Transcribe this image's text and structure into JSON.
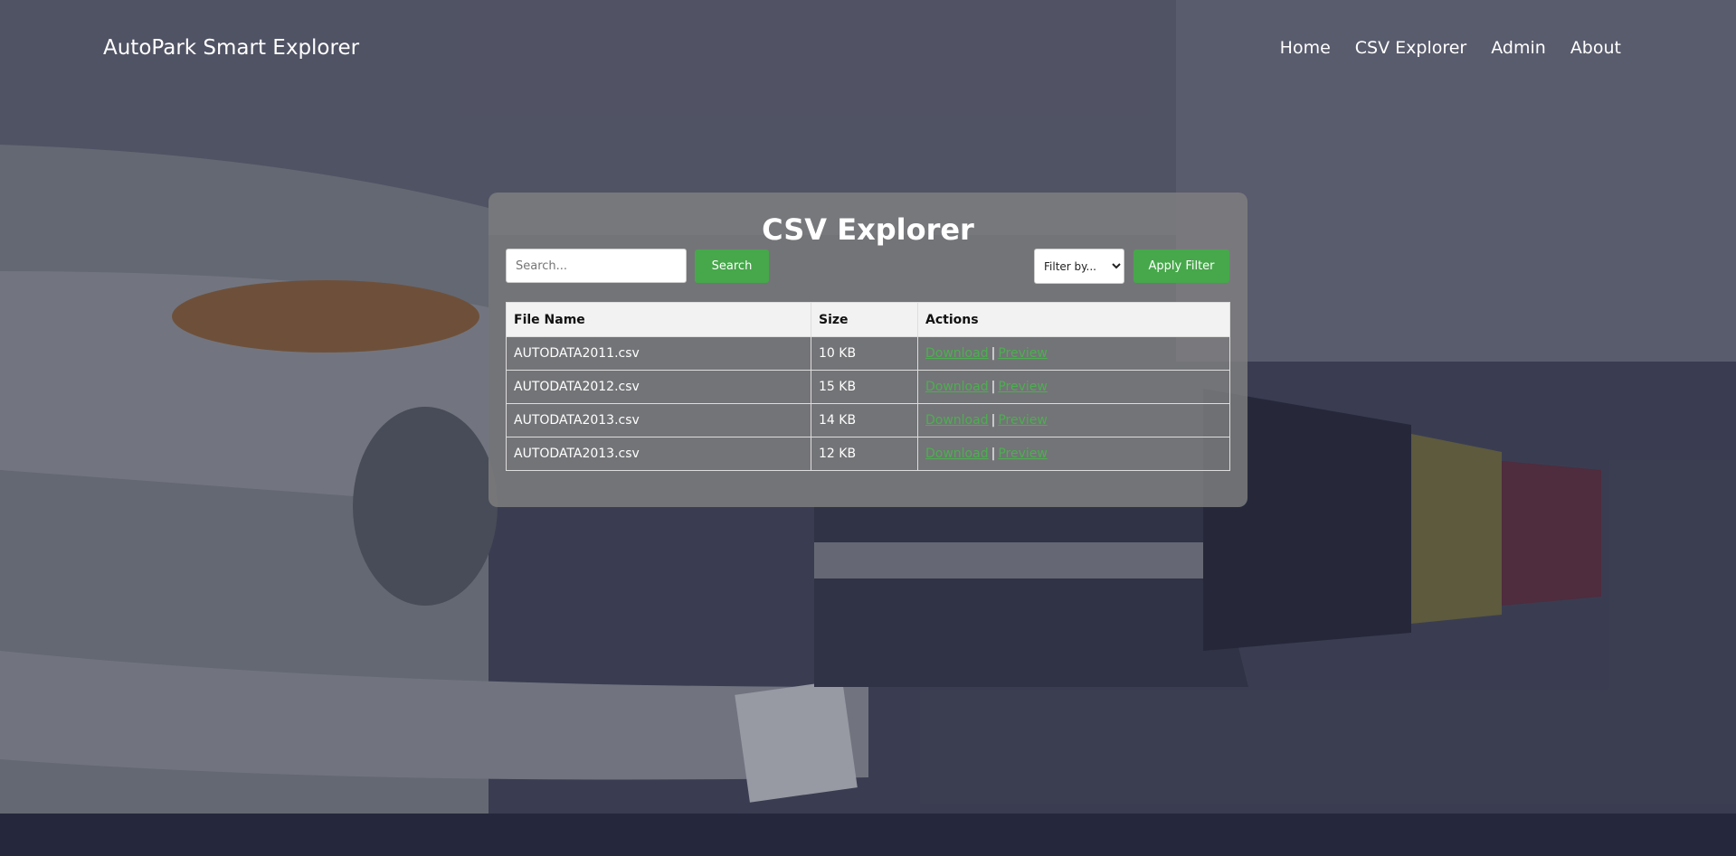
{
  "header": {
    "brand": "AutoPark Smart Explorer",
    "nav": [
      "Home",
      "CSV Explorer",
      "Admin",
      "About"
    ]
  },
  "panel": {
    "title": "CSV Explorer",
    "search_placeholder": "Search...",
    "search_button": "Search",
    "filter_selected": "Filter by...",
    "apply_button": "Apply Filter"
  },
  "table": {
    "columns": [
      "File Name",
      "Size",
      "Actions"
    ],
    "rows": [
      {
        "name": "AUTODATA2011.csv",
        "size": "10 KB",
        "download": "Download",
        "separator": "|",
        "preview": "Preview"
      },
      {
        "name": "AUTODATA2012.csv",
        "size": "15 KB",
        "download": "Download",
        "separator": "|",
        "preview": "Preview"
      },
      {
        "name": "AUTODATA2013.csv",
        "size": "14 KB",
        "download": "Download",
        "separator": "|",
        "preview": "Preview"
      },
      {
        "name": "AUTODATA2013.csv",
        "size": "12 KB",
        "download": "Download",
        "separator": "|",
        "preview": "Preview"
      }
    ]
  },
  "colors": {
    "accent_green": "#46a84a",
    "link_green": "#4caf50",
    "panel_bg": "#808080"
  }
}
